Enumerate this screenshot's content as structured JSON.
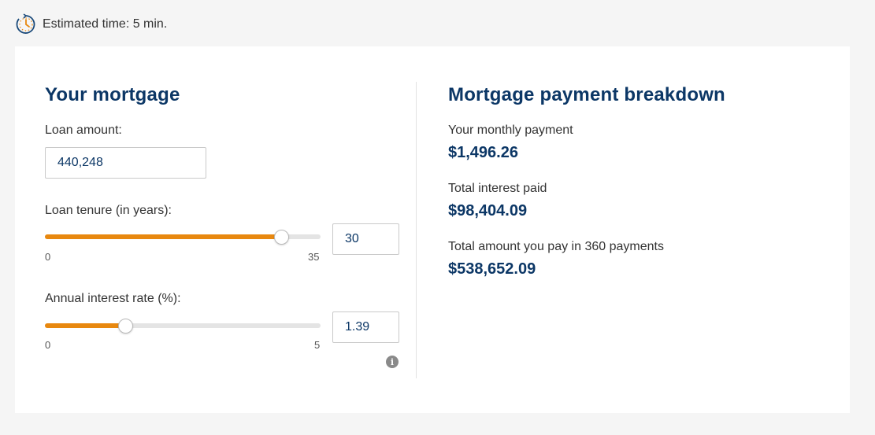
{
  "header": {
    "estimated_time": "Estimated time: 5 min.",
    "icon": "clock-icon"
  },
  "mortgage": {
    "title": "Your mortgage",
    "loan_amount_label": "Loan amount:",
    "loan_amount_value": "440,248",
    "tenure_label": "Loan tenure (in years):",
    "tenure_value": "30",
    "tenure_min": "0",
    "tenure_max": "35",
    "tenure_fraction": 0.857,
    "rate_label": "Annual interest rate (%):",
    "rate_value": "1.39",
    "rate_min": "0",
    "rate_max": "5",
    "rate_fraction": 0.292
  },
  "breakdown": {
    "title": "Mortgage payment breakdown",
    "monthly_label": "Your monthly payment",
    "monthly_value": "$1,496.26",
    "interest_label": "Total interest paid",
    "interest_value": "$98,404.09",
    "total_label": "Total amount you pay in 360 payments",
    "total_value": "$538,652.09"
  },
  "colors": {
    "accent": "#e8880f",
    "heading": "#0c3766"
  }
}
